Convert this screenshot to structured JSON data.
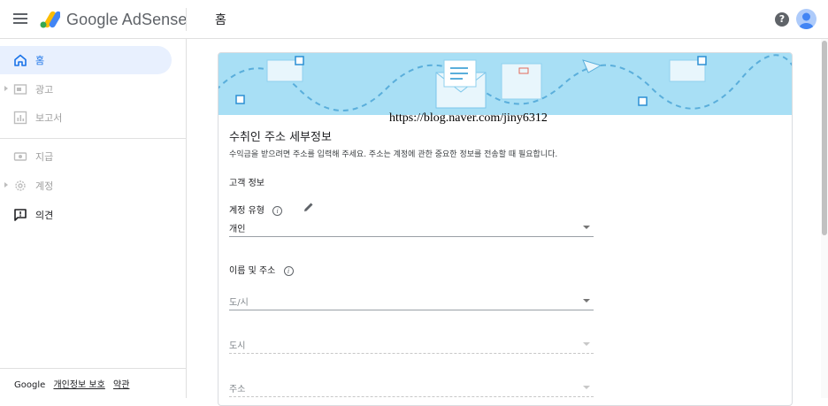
{
  "header": {
    "brand": "Google AdSense",
    "page_title": "홈",
    "help_symbol": "?"
  },
  "sidebar": {
    "items": [
      {
        "label": "홈",
        "icon": "home-icon",
        "state": "active"
      },
      {
        "label": "광고",
        "icon": "ads-icon",
        "state": "disabled"
      },
      {
        "label": "보고서",
        "icon": "reports-icon",
        "state": "disabled"
      },
      {
        "label": "지급",
        "icon": "payments-icon",
        "state": "disabled"
      },
      {
        "label": "계정",
        "icon": "gear-icon",
        "state": "disabled"
      },
      {
        "label": "의견",
        "icon": "feedback-icon",
        "state": "enabled"
      }
    ],
    "footer": {
      "google": "Google",
      "privacy": "개인정보 보호",
      "terms": "약관"
    }
  },
  "card": {
    "watermark": "https://blog.naver.com/jiny6312",
    "title": "수취인 주소 세부정보",
    "description": "수익금을 받으려면 주소를 입력해 주세요. 주소는 계정에 관한 중요한 정보를 전송할 때 필요합니다.",
    "customer_info": "고객 정보",
    "account_type_label": "계정 유형",
    "account_type_value": "개인",
    "name_address_label": "이름 및 주소",
    "province_placeholder": "도/시",
    "city_placeholder": "도시",
    "address_placeholder": "주소"
  },
  "colors": {
    "accent": "#1a73e8",
    "banner": "#a8dff5",
    "active_bg": "#e8f0fe"
  }
}
